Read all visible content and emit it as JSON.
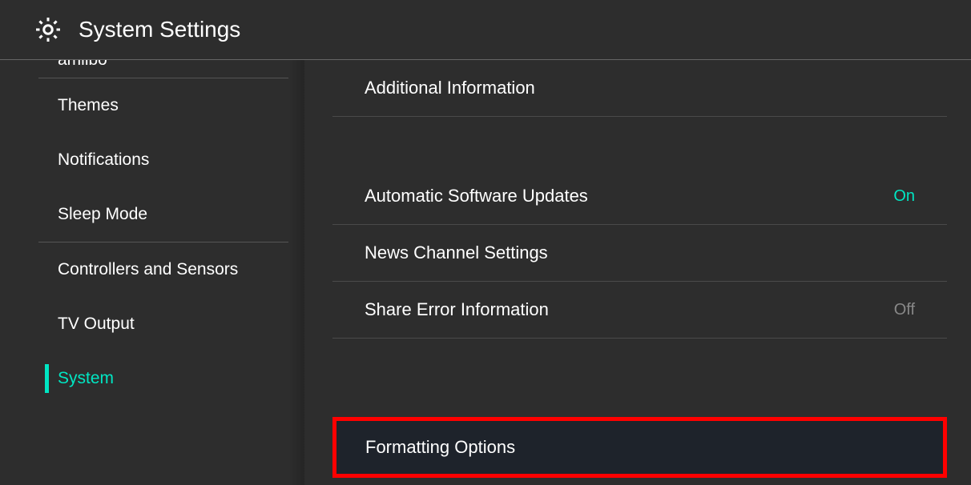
{
  "header": {
    "title": "System Settings"
  },
  "sidebar": {
    "items": [
      {
        "label": "amiibo"
      },
      {
        "label": "Themes"
      },
      {
        "label": "Notifications"
      },
      {
        "label": "Sleep Mode"
      },
      {
        "label": "Controllers and Sensors"
      },
      {
        "label": "TV Output"
      },
      {
        "label": "System"
      }
    ]
  },
  "content": {
    "items": [
      {
        "label": "Additional Information",
        "value": ""
      },
      {
        "label": "Automatic Software Updates",
        "value": "On",
        "valueClass": "on"
      },
      {
        "label": "News Channel Settings",
        "value": ""
      },
      {
        "label": "Share Error Information",
        "value": "Off",
        "valueClass": "off"
      },
      {
        "label": "Formatting Options",
        "value": "",
        "highlighted": true
      }
    ]
  },
  "colors": {
    "accent": "#00e6c3",
    "highlight_border": "#ff0000",
    "highlight_bg": "#1e232b"
  }
}
